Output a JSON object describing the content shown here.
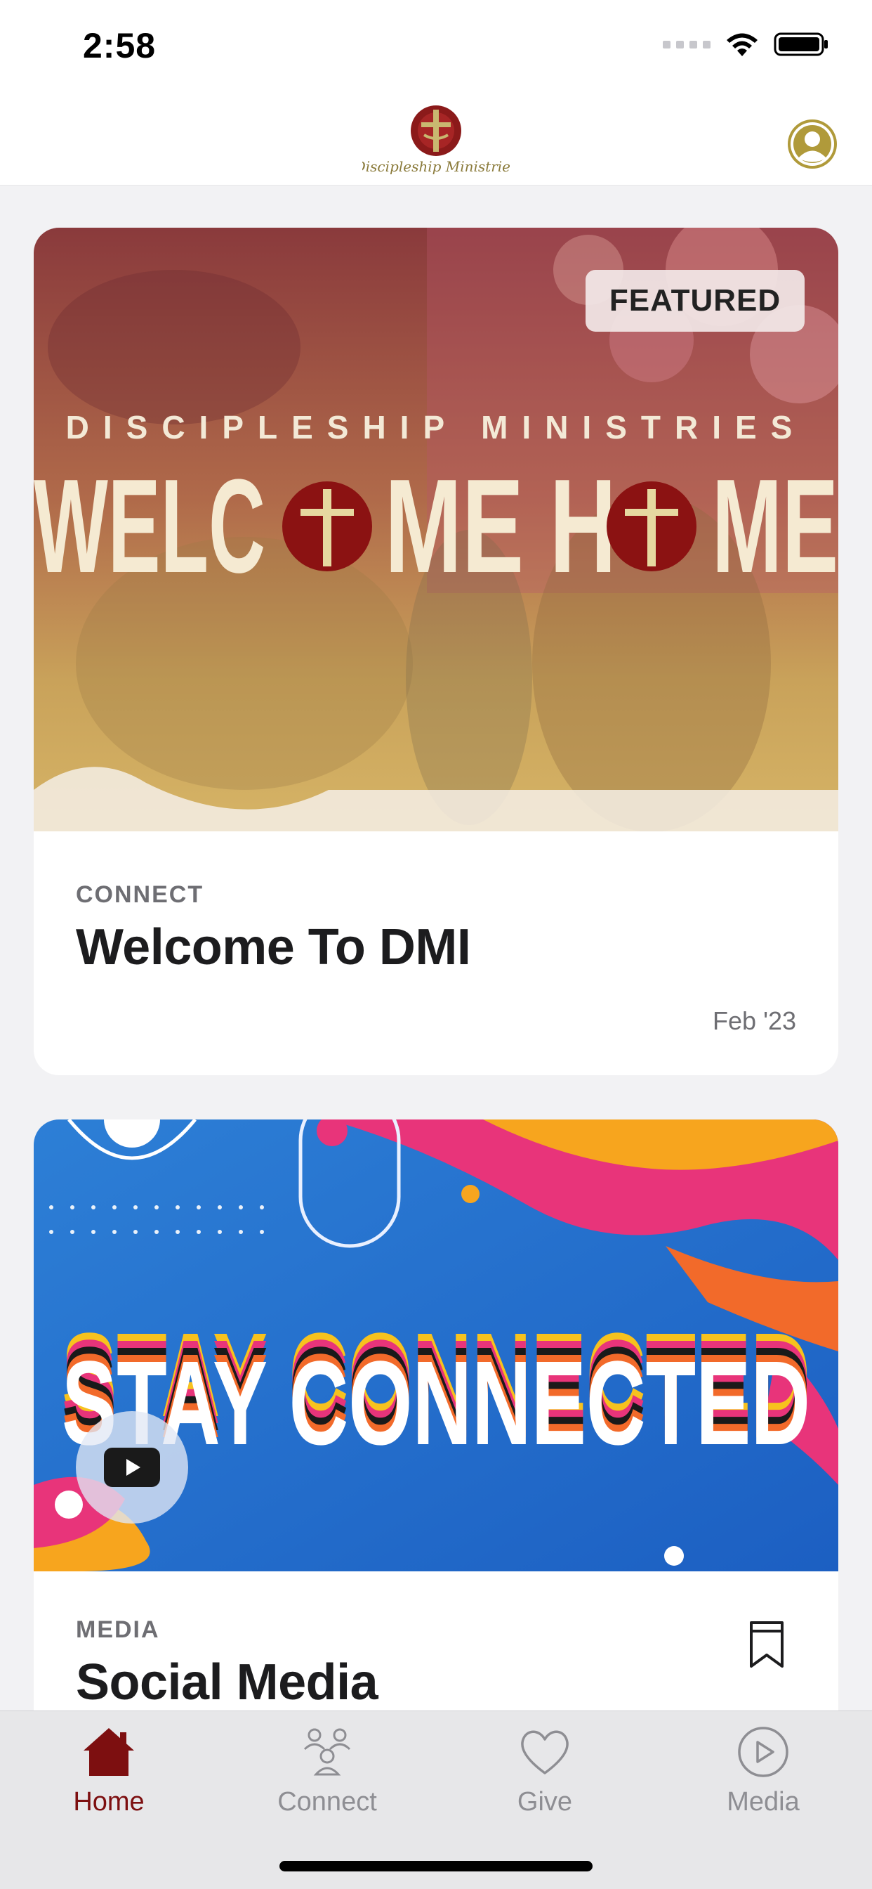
{
  "status_bar": {
    "time": "2:58"
  },
  "header": {
    "logo_text": "Discipleship Ministries"
  },
  "cards": [
    {
      "badge": "FEATURED",
      "hero_top_text": "DISCIPLESHIP MINISTRIES",
      "hero_main_left": "WELC",
      "hero_main_mid": "ME H",
      "hero_main_right": "ME",
      "category": "CONNECT",
      "title": "Welcome To DMI",
      "date": "Feb '23"
    },
    {
      "hero_text": "STAY CONNECTED",
      "category": "MEDIA",
      "title": "Social Media"
    }
  ],
  "tabs": [
    {
      "label": "Home",
      "icon": "home-icon"
    },
    {
      "label": "Connect",
      "icon": "people-icon"
    },
    {
      "label": "Give",
      "icon": "heart-icon"
    },
    {
      "label": "Media",
      "icon": "play-circle-icon"
    }
  ],
  "colors": {
    "accent": "#7d0f10",
    "inactive_tab": "#8e8e93",
    "profile": "#b09a3a"
  }
}
